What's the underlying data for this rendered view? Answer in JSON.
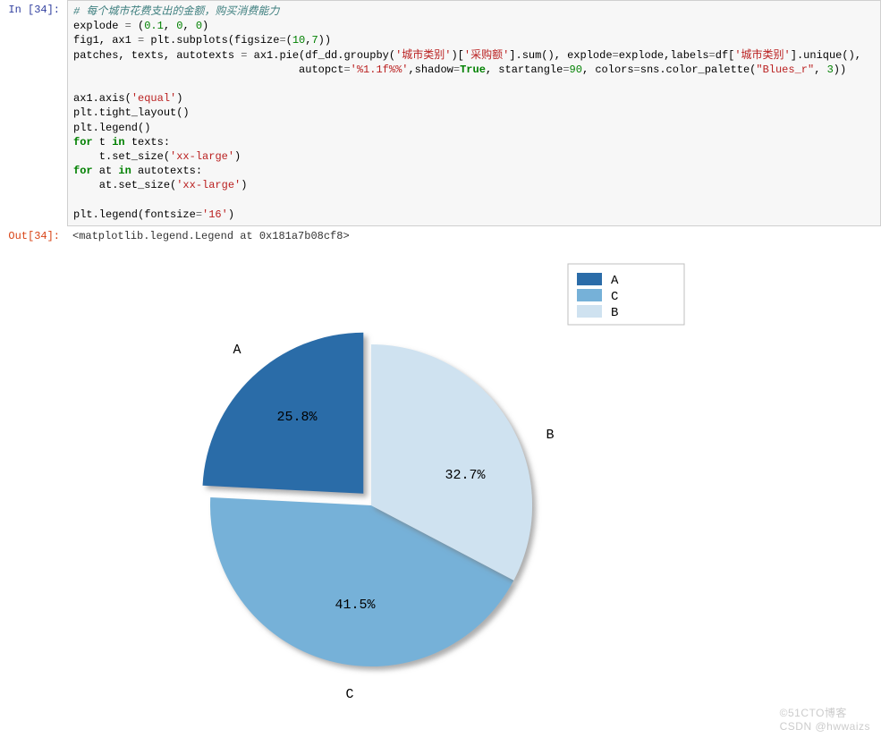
{
  "cell": {
    "in_prompt": "In  [34]:",
    "out_prompt": "Out[34]:",
    "out_text": "<matplotlib.legend.Legend at 0x181a7b08cf8>",
    "code": {
      "comment": "# 每个城市花费支出的金额，购买消费能力",
      "l2a": "explode ",
      "l2b": "=",
      "l2c": " (",
      "l2d": "0.1",
      "l2e": ", ",
      "l2f": "0",
      "l2g": ", ",
      "l2h": "0",
      "l2i": ")",
      "l3a": "fig1, ax1 ",
      "l3b": "=",
      "l3c": " plt.subplots(figsize",
      "l3d": "=",
      "l3e": "(",
      "l3f": "10",
      "l3g": ",",
      "l3h": "7",
      "l3i": "))",
      "l4a": "patches, texts, autotexts ",
      "l4b": "=",
      "l4c": " ax1.pie(df_dd.groupby(",
      "l4d": "'城市类别'",
      "l4e": ")[",
      "l4f": "'采购额'",
      "l4g": "].sum(), explode",
      "l4h": "=",
      "l4i": "explode,labels",
      "l4j": "=",
      "l4k": "df[",
      "l4l": "'城市类别'",
      "l4m": "].unique(),",
      "l5a": "                                   autopct",
      "l5b": "=",
      "l5c": "'%1.1f%%'",
      "l5d": ",shadow",
      "l5e": "=",
      "l5f": "True",
      "l5g": ", startangle",
      "l5h": "=",
      "l5i": "90",
      "l5j": ", colors",
      "l5k": "=",
      "l5l": "sns.color_palette(",
      "l5m": "\"Blues_r\"",
      "l5n": ", ",
      "l5o": "3",
      "l5p": "))",
      "l7a": "ax1.axis(",
      "l7b": "'equal'",
      "l7c": ")",
      "l8": "plt.tight_layout()",
      "l9": "plt.legend()",
      "l10a": "for",
      "l10b": " t ",
      "l10c": "in",
      "l10d": " texts:",
      "l11a": "    t.set_size(",
      "l11b": "'xx-large'",
      "l11c": ")",
      "l12a": "for",
      "l12b": " at ",
      "l12c": "in",
      "l12d": " autotexts:",
      "l13a": "    at.set_size(",
      "l13b": "'xx-large'",
      "l13c": ")",
      "l15a": "plt.legend(fontsize",
      "l15b": "=",
      "l15c": "'16'",
      "l15d": ")"
    }
  },
  "chart_data": {
    "type": "pie",
    "title": "",
    "slices": [
      {
        "label": "A",
        "value": 25.8,
        "pct_text": "25.8%",
        "color": "#2B6CA8",
        "exploded": true
      },
      {
        "label": "B",
        "value": 32.7,
        "pct_text": "32.7%",
        "color": "#CFE2F0",
        "exploded": false
      },
      {
        "label": "C",
        "value": 41.5,
        "pct_text": "41.5%",
        "color": "#76B1D8",
        "exploded": false
      }
    ],
    "start_angle_deg": 90,
    "direction": "counterclockwise",
    "shadow": true,
    "legend": {
      "position": "upper-right",
      "entries": [
        "A",
        "C",
        "B"
      ]
    },
    "colors": {
      "A": "#2B6CA8",
      "C": "#76B1D8",
      "B": "#CFE2F0"
    }
  },
  "watermarks": {
    "right1": "©51CTO博客",
    "right2": "CSDN @hwwaizs"
  }
}
